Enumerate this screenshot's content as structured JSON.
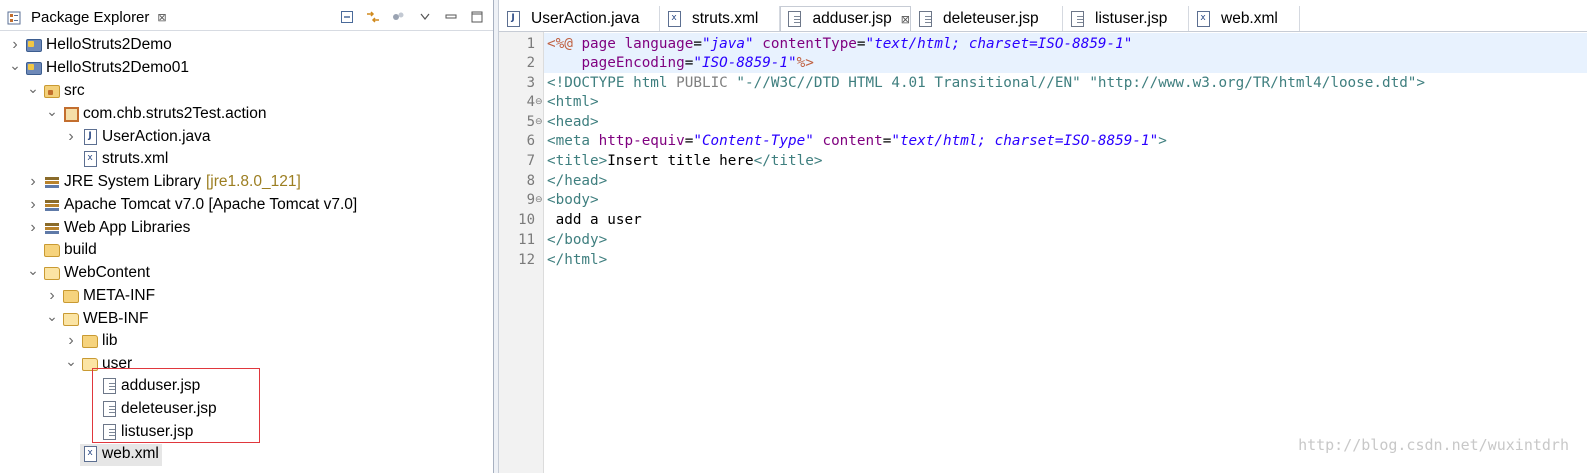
{
  "package_explorer": {
    "title": "Package Explorer",
    "close_glyph": "⊠",
    "toolbar": [
      "collapse-all-icon",
      "link-with-editor-icon",
      "filters-icon",
      "view-menu-icon",
      "minimize-icon",
      "maximize-icon"
    ],
    "tree": [
      {
        "label": "HelloStruts2Demo",
        "icon": "project-icon",
        "twist": "collapsed"
      },
      {
        "label": "HelloStruts2Demo01",
        "icon": "project-icon",
        "twist": "expanded"
      },
      {
        "label": "src",
        "icon": "source-folder-icon",
        "twist": "expanded"
      },
      {
        "label": "com.chb.struts2Test.action",
        "icon": "package-icon",
        "twist": "expanded"
      },
      {
        "label": "UserAction.java",
        "icon": "java-file-icon",
        "twist": "collapsed"
      },
      {
        "label": "struts.xml",
        "icon": "xml-file-icon",
        "twist": "none"
      },
      {
        "label": "JRE System Library",
        "decoration": "[jre1.8.0_121]",
        "icon": "library-icon",
        "twist": "collapsed"
      },
      {
        "label": "Apache Tomcat v7.0 [Apache Tomcat v7.0]",
        "icon": "library-icon",
        "twist": "collapsed"
      },
      {
        "label": "Web App Libraries",
        "icon": "library-icon",
        "twist": "collapsed"
      },
      {
        "label": "build",
        "icon": "folder-icon",
        "twist": "none"
      },
      {
        "label": "WebContent",
        "icon": "folder-open-icon",
        "twist": "expanded"
      },
      {
        "label": "META-INF",
        "icon": "folder-icon",
        "twist": "collapsed"
      },
      {
        "label": "WEB-INF",
        "icon": "folder-open-icon",
        "twist": "expanded"
      },
      {
        "label": "lib",
        "icon": "folder-icon",
        "twist": "collapsed"
      },
      {
        "label": "user",
        "icon": "folder-open-icon",
        "twist": "expanded"
      },
      {
        "label": "adduser.jsp",
        "icon": "jsp-file-icon",
        "twist": "none"
      },
      {
        "label": "deleteuser.jsp",
        "icon": "jsp-file-icon",
        "twist": "none"
      },
      {
        "label": "listuser.jsp",
        "icon": "jsp-file-icon",
        "twist": "none"
      },
      {
        "label": "web.xml",
        "icon": "xml-file-icon",
        "twist": "none",
        "selected": true
      }
    ]
  },
  "editor": {
    "tabs": [
      {
        "label": "UserAction.java",
        "icon": "java-file-icon"
      },
      {
        "label": "struts.xml",
        "icon": "xml-file-icon"
      },
      {
        "label": "adduser.jsp",
        "icon": "jsp-file-icon",
        "active": true,
        "close_glyph": "⊠"
      },
      {
        "label": "deleteuser.jsp",
        "icon": "jsp-file-icon"
      },
      {
        "label": "listuser.jsp",
        "icon": "jsp-file-icon"
      },
      {
        "label": "web.xml",
        "icon": "xml-file-icon"
      }
    ],
    "line_numbers": [
      "1",
      "2",
      "3",
      "4",
      "5",
      "6",
      "7",
      "8",
      "9",
      "10",
      "11",
      "12"
    ],
    "fold_markers": {
      "4": "⊖",
      "5": "⊖",
      "9": "⊖"
    },
    "code": {
      "l1": {
        "open": "<%@",
        "kw": "page",
        "a1": "language",
        "v1": "\"java\"",
        "a2": "contentType",
        "v2": "\"text/html; charset=ISO-8859-1\""
      },
      "l2": {
        "a": "pageEncoding",
        "v": "\"ISO-8859-1\"",
        "close": "%>"
      },
      "l3": {
        "lt": "<!",
        "doctype": "DOCTYPE",
        "html": "html",
        "public": "PUBLIC",
        "s1": "\"-//W3C//DTD HTML 4.01 Transitional//EN\"",
        "s2": "\"http://www.w3.org/TR/html4/loose.dtd\"",
        "gt": ">"
      },
      "l4": "<html>",
      "l5": "<head>",
      "l6": {
        "open": "<meta",
        "a1": "http-equiv",
        "v1": "\"Content-Type\"",
        "a2": "content",
        "v2": "\"text/html; charset=ISO-8859-1\"",
        "close": ">"
      },
      "l7": {
        "open": "<title>",
        "text": "Insert title here",
        "close": "</title>"
      },
      "l8": "</head>",
      "l9": "<body>",
      "l10": " add a user",
      "l11": "</body>",
      "l12": "</html>"
    }
  },
  "watermark": "http://blog.csdn.net/wuxintdrh",
  "colors": {
    "highlight_box": "#e0373d",
    "current_line": "#e8f2fe",
    "tag": "#3f7f7f",
    "attr": "#7f007f",
    "value": "#2a00ff"
  }
}
